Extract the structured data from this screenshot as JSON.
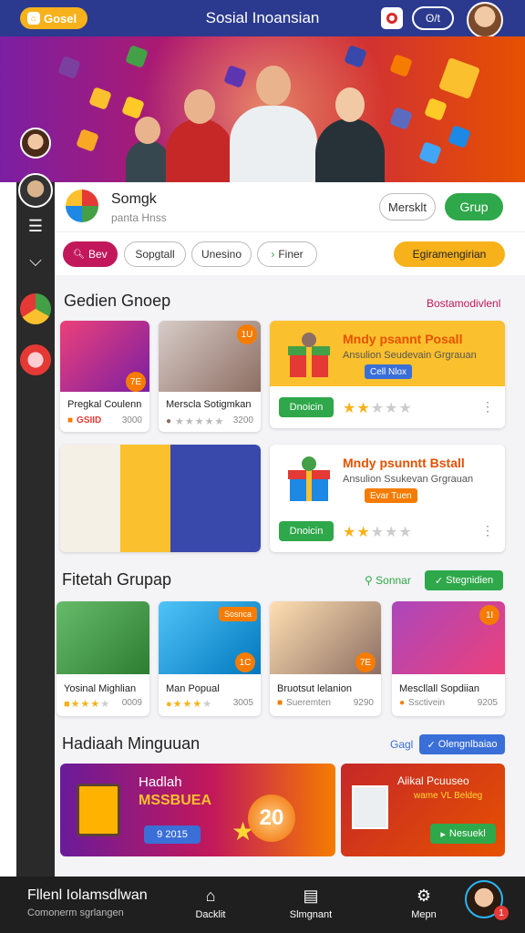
{
  "topbar": {
    "brand_label": "Gosel",
    "title": "Sosial Inoansian",
    "pill_label": "ʘ/t"
  },
  "sidebar": {
    "items": [
      {
        "icon": "avatar"
      },
      {
        "icon": "menu-icon"
      },
      {
        "icon": "tag-icon"
      },
      {
        "icon": "avatar"
      },
      {
        "icon": "avatar"
      }
    ]
  },
  "profile": {
    "name": "Somgk",
    "subtitle": "panta Hnss",
    "outline_button": "Mersklt",
    "primary_button": "Grup"
  },
  "filters": {
    "chips": [
      "Bev",
      "Sopgtall",
      "Unesino",
      "Finer"
    ],
    "right_chip": "Egiramengirian"
  },
  "section1": {
    "title": "Gedien Gnoep",
    "link": "Bostamodivlenl",
    "cards": [
      {
        "title": "Pregkal Coulenn",
        "tag": "GSIID",
        "num": "3000",
        "badge": "7E"
      },
      {
        "title": "Merscla Sotigmkan",
        "tag": "★★★★★",
        "num": "3200",
        "badge": "1U"
      }
    ],
    "promos": [
      {
        "title": "Mndy psannt Posall",
        "subtitle": "Ansulion Seudevain Grgrauan",
        "tag": "Cell Nlox",
        "button": "Dnoicin"
      },
      {
        "title": "Mndy psunntt Bstall",
        "subtitle": "Ansulion Ssukevan Grgrauan",
        "tag": "Evar Tuen",
        "button": "Dnoicin"
      }
    ]
  },
  "section2": {
    "title": "Fitetah Grupap",
    "link": "Sonnar",
    "button": "Stegnidien",
    "cards": [
      {
        "title": "Yosinal Mighlian",
        "num": "0009",
        "badge": ""
      },
      {
        "title": "Man Popual",
        "num": "3005",
        "badge": "1C",
        "label": "Sosnca"
      },
      {
        "title": "Bruotsut lelanion",
        "meta": "Sueremten",
        "num": "9290",
        "badge": "7E"
      },
      {
        "title": "Mescllall Sopdiian",
        "meta": "Ssctivein",
        "num": "9205",
        "badge": "1I"
      }
    ]
  },
  "section3": {
    "title": "Hadiaah Minguuan",
    "link": "Gagl",
    "button": "Olengnlbaiao",
    "banner1": {
      "title": "Hadlah",
      "subtitle": "MSSBUEA",
      "tag": "9 2015",
      "big_number": "20"
    },
    "banner2": {
      "title": "Aiikal Pcuuseo",
      "subtitle": "wame VL Beldeg",
      "button": "Nesuekl"
    }
  },
  "bottomnav": {
    "title": "Fllenl Iolamsdlwan",
    "subtitle": "Comonerm sgrlangen",
    "items": [
      "Dacklit",
      "Slmgnant",
      "Mepn"
    ],
    "notif": "1"
  },
  "colors": {
    "topbar": "#2b3a8f",
    "accent_pink": "#c2185b",
    "accent_green": "#2ea84a",
    "accent_yellow": "#f7b21b",
    "accent_blue": "#3a6fd8"
  }
}
